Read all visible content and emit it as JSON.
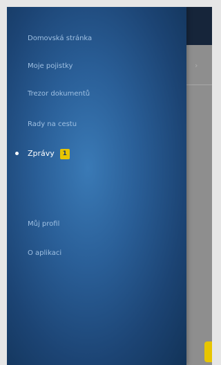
{
  "menu": {
    "items": [
      {
        "label": "Domovská stránka"
      },
      {
        "label": "Moje pojistky"
      },
      {
        "label": "Trezor dokumentů"
      },
      {
        "label": "Rady na cestu"
      },
      {
        "label": "Zprávy",
        "badge": "1",
        "active": true
      },
      {
        "label": "Můj profil"
      },
      {
        "label": "O aplikaci"
      }
    ]
  },
  "content": {
    "chevron": "›"
  },
  "colors": {
    "drawer_center": "#3a7ab6",
    "drawer_edge": "#123358",
    "menu_text": "#9fc0e2",
    "active_text": "#ffffff",
    "badge": "#e7c500",
    "header": "#16253a"
  }
}
